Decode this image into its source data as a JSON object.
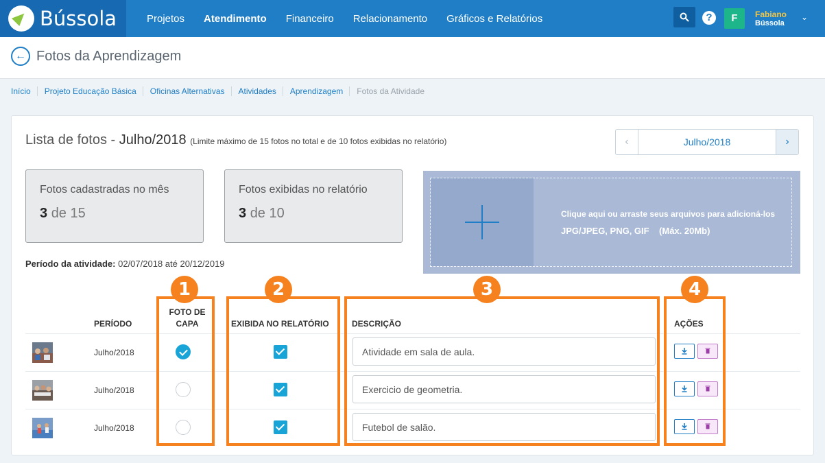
{
  "header": {
    "brand": "Bússola",
    "nav": [
      "Projetos",
      "Atendimento",
      "Financeiro",
      "Relacionamento",
      "Gráficos e Relatórios"
    ],
    "active_nav": "Atendimento",
    "help": "?",
    "user": {
      "initial": "F",
      "name": "Fabiano",
      "org": "Bússola"
    }
  },
  "page": {
    "title": "Fotos da Aprendizagem"
  },
  "breadcrumb": [
    "Início",
    "Projeto Educação Básica",
    "Oficinas Alternativas",
    "Atividades",
    "Aprendizagem",
    "Fotos da Atividade"
  ],
  "list": {
    "title_prefix": "Lista de fotos - ",
    "title_month": "Julho/2018",
    "limit_note": "(Limite máximo de 15 fotos no total e de 10 fotos exibidas no relatório)"
  },
  "month_selector": {
    "value": "Julho/2018"
  },
  "stats": [
    {
      "label": "Fotos cadastradas no mês",
      "count": "3",
      "of": "de",
      "total": "15"
    },
    {
      "label": "Fotos exibidas no relatório",
      "count": "3",
      "of": "de",
      "total": "10"
    }
  ],
  "period": {
    "label": "Período da atividade:",
    "value": "02/07/2018 até 20/12/2019"
  },
  "upload": {
    "line1": "Clique aqui ou arraste seus arquivos para adicioná-los",
    "line2": "JPG/JPEG, PNG, GIF    (Máx. 20Mb)"
  },
  "table": {
    "headers": {
      "period": "PERÍODO",
      "cover_1": "FOTO DE",
      "cover_2": "CAPA",
      "report": "EXIBIDA NO RELATÓRIO",
      "description": "DESCRIÇÃO",
      "actions": "AÇÕES"
    },
    "rows": [
      {
        "period": "Julho/2018",
        "cover": true,
        "in_report": true,
        "description": "Atividade em sala de aula."
      },
      {
        "period": "Julho/2018",
        "cover": false,
        "in_report": true,
        "description": "Exercicio de geometria."
      },
      {
        "period": "Julho/2018",
        "cover": false,
        "in_report": true,
        "description": "Futebol de salão."
      }
    ]
  },
  "annotations": [
    "1",
    "2",
    "3",
    "4"
  ],
  "colors": {
    "primary": "#1f7ec5",
    "annotation": "#f5821f",
    "check": "#19a4d8",
    "avatar": "#1db58a"
  }
}
